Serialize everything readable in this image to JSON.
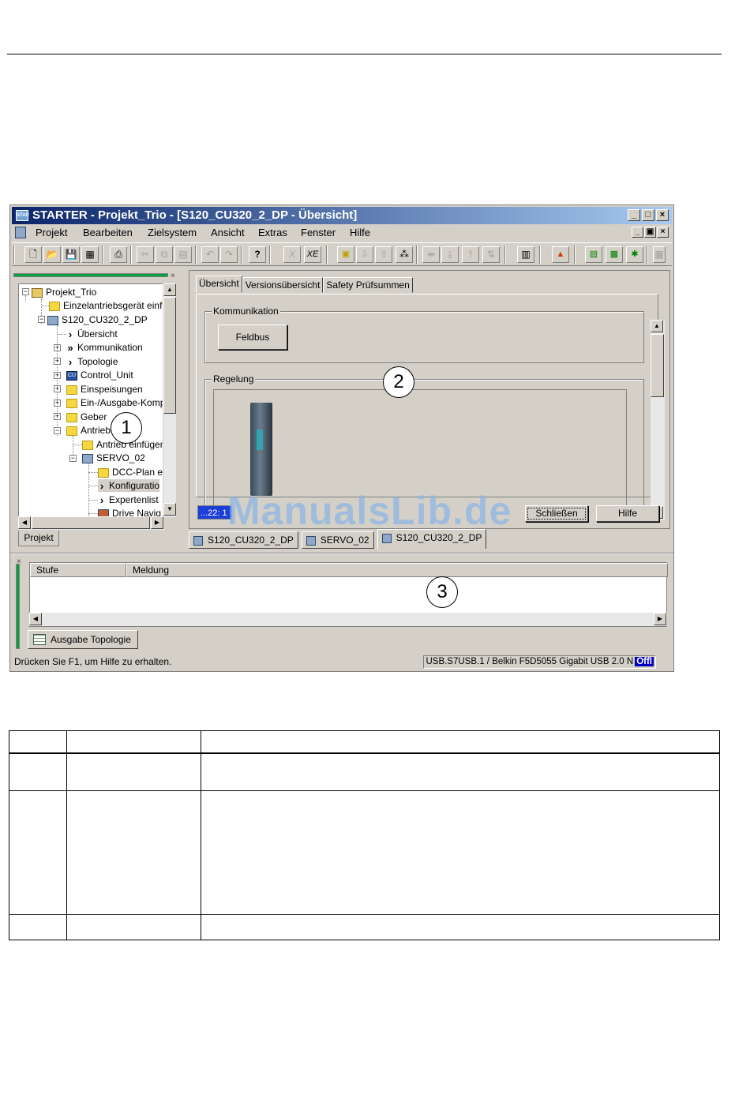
{
  "window": {
    "title": "STARTER - Projekt_Trio - [S120_CU320_2_DP - Übersicht]",
    "app_icon_label": "STAR",
    "buttons": {
      "minimize": "_",
      "maximize": "□",
      "close": "×"
    },
    "mdi_buttons": {
      "minimize": "_",
      "restore": "▣",
      "close": "×"
    }
  },
  "menu": {
    "items": [
      "Projekt",
      "Bearbeiten",
      "Zielsystem",
      "Ansicht",
      "Extras",
      "Fenster",
      "Hilfe"
    ]
  },
  "toolbar": {
    "icons": [
      "new-icon",
      "open-icon",
      "save-icon",
      "save-compile-icon",
      "print-icon",
      "cut-icon",
      "copy-icon",
      "paste-icon",
      "undo-icon",
      "redo-icon",
      "help-context-icon",
      "x-icon",
      "xe-icon",
      "network-icon",
      "download-icon",
      "upload-icon",
      "accessible-nodes-icon",
      "connect-icon",
      "load-to-pg-icon",
      "load-to-target-icon",
      "copy-ram-rom-icon",
      "display-icon",
      "device-icon",
      "trace-icon",
      "oscilloscope-icon",
      "measure-icon",
      "more-icon"
    ],
    "x_label": "X",
    "xe_label": "XE"
  },
  "tree": {
    "close_label": "×",
    "nodes": [
      "Projekt_Trio",
      "Einzelantriebsgerät einf",
      "S120_CU320_2_DP",
      "Übersicht",
      "Kommunikation",
      "Topologie",
      "Control_Unit",
      "Einspeisungen",
      "Ein-/Ausgabe-Komp",
      "Geber",
      "Antriebe",
      "Antrieb einfügen",
      "SERVO_02",
      "DCC-Plan ei",
      "Konfiguratio",
      "Expertenlist",
      "Drive Navig"
    ],
    "cu_label": "CU",
    "tab_label": "Projekt"
  },
  "panel": {
    "tabs": [
      "Übersicht",
      "Versionsübersicht",
      "Safety Prüfsummen"
    ],
    "group_kommunikation": "Kommunikation",
    "feldbus_button": "Feldbus",
    "group_regelung": "Regelung",
    "status_field": "...22: 1",
    "close_button": "Schließen",
    "help_button": "Hilfe"
  },
  "doc_tabs": [
    "S120_CU320_2_DP",
    "SERVO_02",
    "S120_CU320_2_DP"
  ],
  "output": {
    "close_label": "×",
    "columns": [
      "Stufe",
      "Meldung"
    ],
    "tab_label": "Ausgabe Topologie"
  },
  "statusbar": {
    "left": "Drücken Sie F1, um Hilfe zu erhalten.",
    "connection": "USB.S7USB.1 / Belkin F5D5055 Gigabit USB 2.0 N",
    "mode": "Offl"
  },
  "callouts": [
    "1",
    "2",
    "3"
  ],
  "watermark": "ManualsLib.de"
}
